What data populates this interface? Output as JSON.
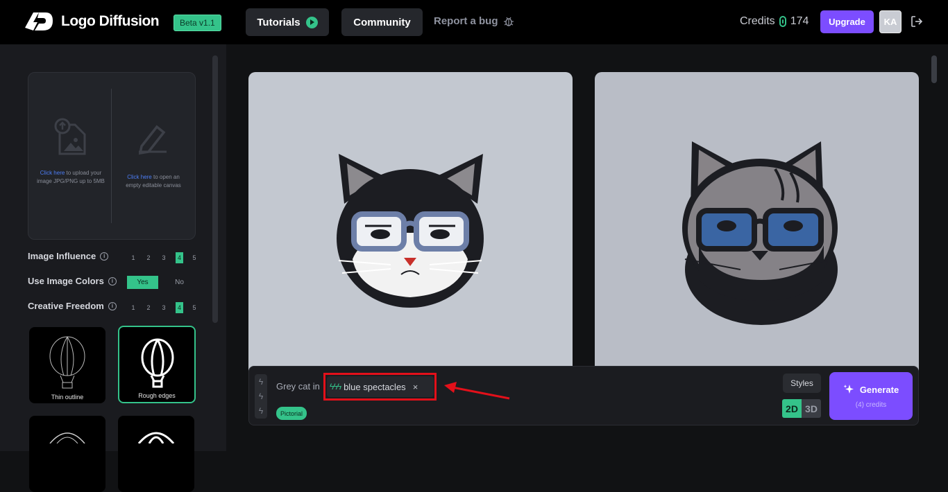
{
  "brand": {
    "name": "Logo Diffusion",
    "badge": "Beta v1.1"
  },
  "nav": {
    "tutorials": "Tutorials",
    "community": "Community",
    "report_bug": "Report a bug"
  },
  "account": {
    "credits_label": "Credits",
    "credits_value": "174",
    "upgrade": "Upgrade",
    "avatar_initials": "KA"
  },
  "upload": {
    "left_link": "Click here",
    "left_text": " to upload your image JPG/PNG up to 5MB",
    "right_link": "Click here",
    "right_text": " to open an empty editable canvas"
  },
  "options": {
    "image_influence": {
      "label": "Image Influence",
      "scale": [
        "1",
        "2",
        "3",
        "4",
        "5"
      ],
      "selected": "4"
    },
    "use_image_colors": {
      "label": "Use Image Colors",
      "yes": "Yes",
      "no": "No",
      "selected": "Yes"
    },
    "creative_freedom": {
      "label": "Creative Freedom",
      "scale": [
        "1",
        "2",
        "3",
        "4",
        "5"
      ],
      "selected": "4"
    }
  },
  "styles_list": [
    {
      "label": "Thin outline"
    },
    {
      "label": "Rough edges",
      "selected": true
    }
  ],
  "prompt": {
    "prefix": "Grey cat in",
    "chip_text": "blue spectacles",
    "chip_bolts": "ϟϟϟ",
    "chip_close": "×",
    "tag": "Pictorial",
    "styles_button": "Styles",
    "dim_2d": "2D",
    "dim_3d": "3D",
    "generate": "Generate",
    "generate_credits": "(4) credits"
  },
  "colors": {
    "accent_green": "#34c38a",
    "accent_purple": "#7c4dff",
    "highlight_red": "#e3101a"
  }
}
